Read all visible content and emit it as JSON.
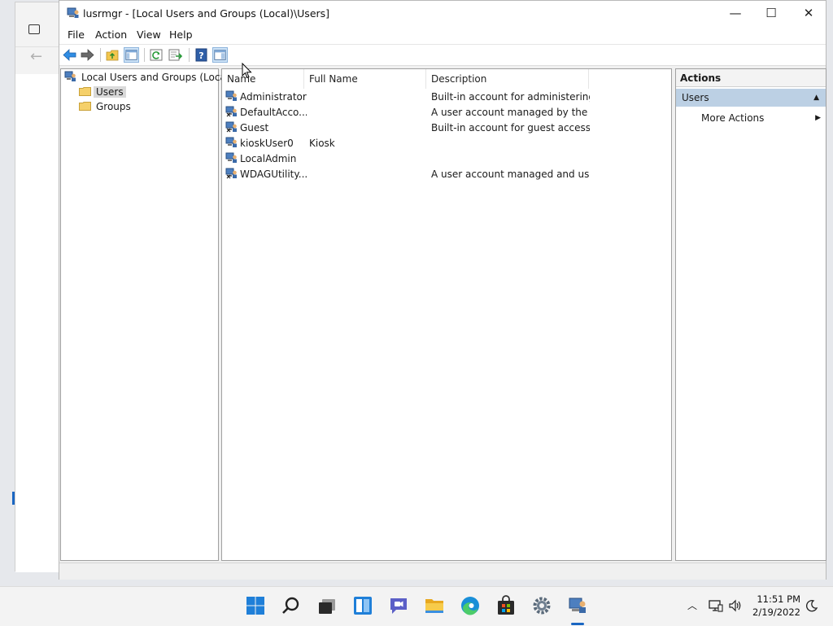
{
  "window": {
    "title": "lusrmgr - [Local Users and Groups (Local)\\Users]",
    "controls": {
      "minimize": "—",
      "maximize": "☐",
      "close": "✕"
    }
  },
  "menu": [
    "File",
    "Action",
    "View",
    "Help"
  ],
  "toolbar": {
    "icons": [
      "back-arrow-icon",
      "forward-arrow-icon",
      "up-folder-icon",
      "show-hide-console-tree-icon",
      "refresh-icon",
      "export-list-icon",
      "help-icon",
      "show-hide-action-pane-icon"
    ]
  },
  "tree": {
    "root": "Local Users and Groups (Local)",
    "children": [
      {
        "label": "Users",
        "selected": true
      },
      {
        "label": "Groups",
        "selected": false
      }
    ]
  },
  "list": {
    "columns": [
      "Name",
      "Full Name",
      "Description"
    ],
    "rows": [
      {
        "name": "Administrator",
        "full_name": "",
        "description": "Built-in account for administering..."
      },
      {
        "name": "DefaultAcco...",
        "full_name": "",
        "description": "A user account managed by the s..."
      },
      {
        "name": "Guest",
        "full_name": "",
        "description": "Built-in account for guest access t..."
      },
      {
        "name": "kioskUser0",
        "full_name": "Kiosk",
        "description": ""
      },
      {
        "name": "LocalAdmin",
        "full_name": "",
        "description": ""
      },
      {
        "name": "WDAGUtility...",
        "full_name": "",
        "description": "A user account managed and use..."
      }
    ]
  },
  "actions": {
    "header": "Actions",
    "section": "Users",
    "items": [
      "More Actions"
    ]
  },
  "taskbar": {
    "icons": [
      "start-icon",
      "search-icon",
      "task-view-icon",
      "widgets-icon",
      "chat-icon",
      "file-explorer-icon",
      "edge-icon",
      "store-icon",
      "settings-icon",
      "lusrmgr-icon"
    ],
    "tray_icons": [
      "chevron-up-icon",
      "network-icon",
      "volume-icon",
      "focus-assist-icon"
    ],
    "time": "11:51 PM",
    "date": "2/19/2022"
  },
  "colors": {
    "selection": "#d9d9d9",
    "action_section": "#bcd0e4",
    "accent": "#1a66c2"
  }
}
